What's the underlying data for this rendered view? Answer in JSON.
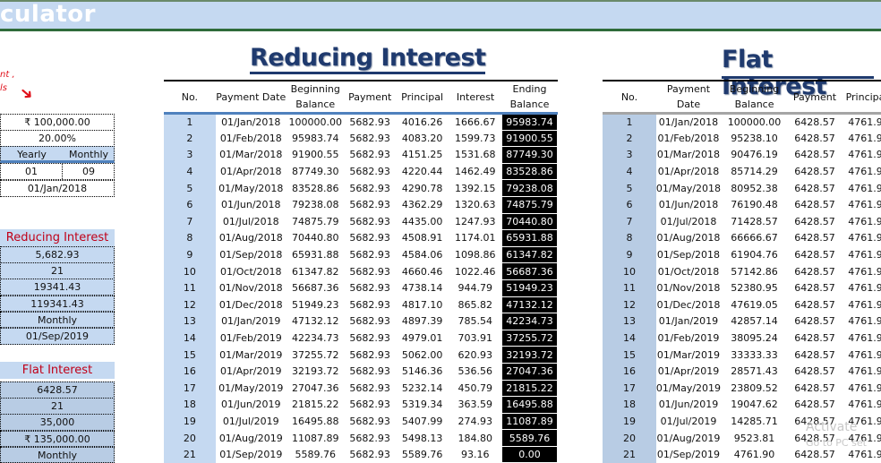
{
  "app": {
    "title_fragment": "culator"
  },
  "annotation": {
    "line1": "nt ,",
    "line2": "ls"
  },
  "inputs": {
    "loan_amount": "₹ 100,000.00",
    "interest_rate": "20.00%",
    "tenure_header": {
      "yearly": "Yearly",
      "monthly": "Monthly"
    },
    "years": "01",
    "months": "09",
    "start_date": "01/Jan/2018"
  },
  "reducing_summary": {
    "title": "Reducing Interest",
    "values": [
      "5,682.93",
      "21",
      "19341.43",
      "119341.43",
      "Monthly",
      "01/Sep/2019"
    ]
  },
  "flat_summary": {
    "title": "Flat Interest",
    "values": [
      "6428.57",
      "21",
      "35,000",
      "₹ 135,000.00",
      "Monthly"
    ]
  },
  "reducing_table": {
    "title": "Reducing Interest",
    "headers": [
      "No.",
      "Payment Date",
      "Beginning Balance",
      "Payment",
      "Principal",
      "Interest",
      "Ending Balance"
    ],
    "rows": [
      [
        "1",
        "01/Jan/2018",
        "100000.00",
        "5682.93",
        "4016.26",
        "1666.67",
        "95983.74"
      ],
      [
        "2",
        "01/Feb/2018",
        "95983.74",
        "5682.93",
        "4083.20",
        "1599.73",
        "91900.55"
      ],
      [
        "3",
        "01/Mar/2018",
        "91900.55",
        "5682.93",
        "4151.25",
        "1531.68",
        "87749.30"
      ],
      [
        "4",
        "01/Apr/2018",
        "87749.30",
        "5682.93",
        "4220.44",
        "1462.49",
        "83528.86"
      ],
      [
        "5",
        "01/May/2018",
        "83528.86",
        "5682.93",
        "4290.78",
        "1392.15",
        "79238.08"
      ],
      [
        "6",
        "01/Jun/2018",
        "79238.08",
        "5682.93",
        "4362.29",
        "1320.63",
        "74875.79"
      ],
      [
        "7",
        "01/Jul/2018",
        "74875.79",
        "5682.93",
        "4435.00",
        "1247.93",
        "70440.80"
      ],
      [
        "8",
        "01/Aug/2018",
        "70440.80",
        "5682.93",
        "4508.91",
        "1174.01",
        "65931.88"
      ],
      [
        "9",
        "01/Sep/2018",
        "65931.88",
        "5682.93",
        "4584.06",
        "1098.86",
        "61347.82"
      ],
      [
        "10",
        "01/Oct/2018",
        "61347.82",
        "5682.93",
        "4660.46",
        "1022.46",
        "56687.36"
      ],
      [
        "11",
        "01/Nov/2018",
        "56687.36",
        "5682.93",
        "4738.14",
        "944.79",
        "51949.23"
      ],
      [
        "12",
        "01/Dec/2018",
        "51949.23",
        "5682.93",
        "4817.10",
        "865.82",
        "47132.12"
      ],
      [
        "13",
        "01/Jan/2019",
        "47132.12",
        "5682.93",
        "4897.39",
        "785.54",
        "42234.73"
      ],
      [
        "14",
        "01/Feb/2019",
        "42234.73",
        "5682.93",
        "4979.01",
        "703.91",
        "37255.72"
      ],
      [
        "15",
        "01/Mar/2019",
        "37255.72",
        "5682.93",
        "5062.00",
        "620.93",
        "32193.72"
      ],
      [
        "16",
        "01/Apr/2019",
        "32193.72",
        "5682.93",
        "5146.36",
        "536.56",
        "27047.36"
      ],
      [
        "17",
        "01/May/2019",
        "27047.36",
        "5682.93",
        "5232.14",
        "450.79",
        "21815.22"
      ],
      [
        "18",
        "01/Jun/2019",
        "21815.22",
        "5682.93",
        "5319.34",
        "363.59",
        "16495.88"
      ],
      [
        "19",
        "01/Jul/2019",
        "16495.88",
        "5682.93",
        "5407.99",
        "274.93",
        "11087.89"
      ],
      [
        "20",
        "01/Aug/2019",
        "11087.89",
        "5682.93",
        "5498.13",
        "184.80",
        "5589.76"
      ],
      [
        "21",
        "01/Sep/2019",
        "5589.76",
        "5682.93",
        "5589.76",
        "93.16",
        "0.00"
      ]
    ]
  },
  "flat_table": {
    "title": "Flat Interest",
    "headers": [
      "No.",
      "Payment Date",
      "Beginning Balance",
      "Payment",
      "Principa"
    ],
    "rows": [
      [
        "1",
        "01/Jan/2018",
        "100000.00",
        "6428.57",
        "4761.9"
      ],
      [
        "2",
        "01/Feb/2018",
        "95238.10",
        "6428.57",
        "4761.9"
      ],
      [
        "3",
        "01/Mar/2018",
        "90476.19",
        "6428.57",
        "4761.9"
      ],
      [
        "4",
        "01/Apr/2018",
        "85714.29",
        "6428.57",
        "4761.9"
      ],
      [
        "5",
        "01/May/2018",
        "80952.38",
        "6428.57",
        "4761.9"
      ],
      [
        "6",
        "01/Jun/2018",
        "76190.48",
        "6428.57",
        "4761.9"
      ],
      [
        "7",
        "01/Jul/2018",
        "71428.57",
        "6428.57",
        "4761.9"
      ],
      [
        "8",
        "01/Aug/2018",
        "66666.67",
        "6428.57",
        "4761.9"
      ],
      [
        "9",
        "01/Sep/2018",
        "61904.76",
        "6428.57",
        "4761.9"
      ],
      [
        "10",
        "01/Oct/2018",
        "57142.86",
        "6428.57",
        "4761.9"
      ],
      [
        "11",
        "01/Nov/2018",
        "52380.95",
        "6428.57",
        "4761.9"
      ],
      [
        "12",
        "01/Dec/2018",
        "47619.05",
        "6428.57",
        "4761.9"
      ],
      [
        "13",
        "01/Jan/2019",
        "42857.14",
        "6428.57",
        "4761.9"
      ],
      [
        "14",
        "01/Feb/2019",
        "38095.24",
        "6428.57",
        "4761.9"
      ],
      [
        "15",
        "01/Mar/2019",
        "33333.33",
        "6428.57",
        "4761.9"
      ],
      [
        "16",
        "01/Apr/2019",
        "28571.43",
        "6428.57",
        "4761.9"
      ],
      [
        "17",
        "01/May/2019",
        "23809.52",
        "6428.57",
        "4761.9"
      ],
      [
        "18",
        "01/Jun/2019",
        "19047.62",
        "6428.57",
        "4761.9"
      ],
      [
        "19",
        "01/Jul/2019",
        "14285.71",
        "6428.57",
        "4761.9"
      ],
      [
        "20",
        "01/Aug/2019",
        "9523.81",
        "6428.57",
        "4761.9"
      ],
      [
        "21",
        "01/Sep/2019",
        "4761.90",
        "6428.57",
        "4761.9"
      ]
    ]
  },
  "watermark": {
    "line1": "Activate",
    "line2": "Go to PC set"
  }
}
